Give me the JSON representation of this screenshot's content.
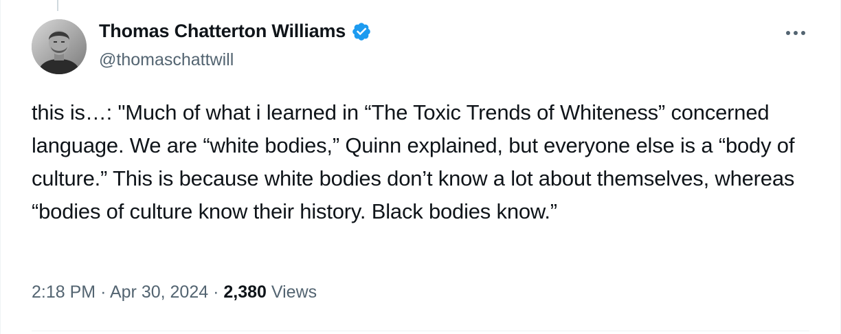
{
  "author": {
    "display_name": "Thomas Chatterton Williams",
    "handle": "@thomaschattwill",
    "verified": true,
    "avatar_icon": "user-avatar-photo"
  },
  "tweet": {
    "text": "this is…: \"Much of what i learned in “The Toxic Trends of Whiteness” concerned language. We are “white bodies,” Quinn explained, but everyone else is a “body of culture.” This is because white bodies don’t know a lot about themselves, whereas “bodies of culture know their history. Black bodies know.”"
  },
  "meta": {
    "time": "2:18 PM",
    "separator": "·",
    "date": "Apr 30, 2024",
    "views_count": "2,380",
    "views_label": "Views"
  },
  "colors": {
    "verified_blue": "#1d9bf0",
    "text_primary": "#0f1419",
    "text_secondary": "#536471"
  },
  "icons": {
    "verified": "verified-badge-icon",
    "more": "more-options-icon"
  }
}
